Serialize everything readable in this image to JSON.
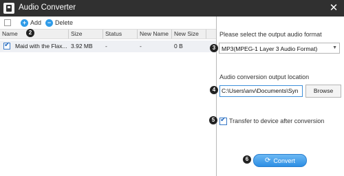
{
  "window": {
    "title": "Audio Converter",
    "close_glyph": "✕"
  },
  "toolbar": {
    "add_label": "Add",
    "delete_label": "Delete",
    "add_icon": "+",
    "delete_icon": "−"
  },
  "table": {
    "columns": [
      "Name",
      "Size",
      "Status",
      "New Name",
      "New Size"
    ],
    "rows": [
      {
        "checked": true,
        "name": "Maid with the Flax...",
        "size": "3.92 MB",
        "status": "-",
        "new_name": "-",
        "new_size": "0 B"
      }
    ]
  },
  "right_panel": {
    "format_label": "Please select the output audio format",
    "format_value": "MP3(MPEG-1 Layer 3 Audio Format)",
    "location_label": "Audio conversion output location",
    "location_value": "C:\\Users\\anv\\Documents\\Syn",
    "browse_label": "Browse",
    "transfer_label": "Transfer to device after conversion",
    "transfer_checked": true,
    "convert_label": "Convert"
  },
  "badges": [
    "2",
    "3",
    "4",
    "5",
    "6"
  ],
  "colors": {
    "titlebar": "#303030",
    "accent": "#2f9be8",
    "convert_button": "#3a97e8"
  }
}
